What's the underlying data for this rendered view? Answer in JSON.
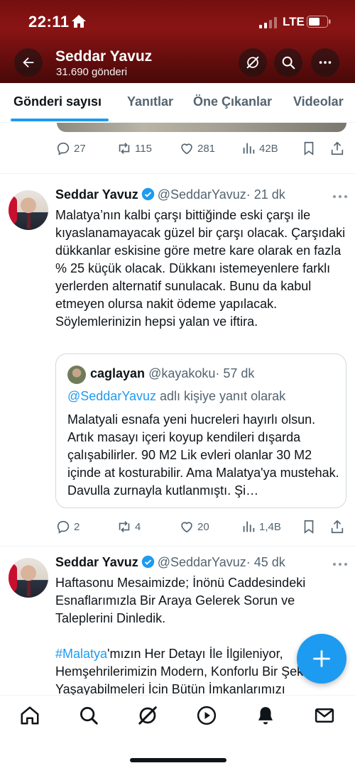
{
  "status_bar": {
    "time": "22:11",
    "network": "LTE"
  },
  "profile": {
    "name": "Seddar Yavuz",
    "post_count": "31.690 gönderi"
  },
  "tabs": [
    {
      "label": "Gönderi sayısı",
      "active": true
    },
    {
      "label": "Yanıtlar",
      "active": false
    },
    {
      "label": "Öne Çıkanlar",
      "active": false
    },
    {
      "label": "Videolar",
      "active": false
    }
  ],
  "tweets": [
    {
      "stats": {
        "replies": "27",
        "reposts": "115",
        "likes": "281",
        "views": "42B"
      }
    },
    {
      "author": "Seddar Yavuz",
      "handle": "@SeddarYavuz",
      "time": "· 21 dk",
      "text": "Malatya’nın kalbi çarşı bittiğinde eski çarşı ile kıyaslanamayacak güzel bir çarşı olacak. Çarşıdaki dükkanlar eskisine göre metre kare olarak en fazla % 25 küçük olacak. Dükkanı istemeyenlere farklı yerlerden alternatif sunulacak. Bunu da kabul etmeyen olursa nakit ödeme yapılacak. Söylemlerinizin hepsi yalan ve iftira.",
      "quote": {
        "author": "caglayan",
        "handle": "@kayakoku",
        "time": "· 57 dk",
        "reply_mention": "@SeddarYavuz",
        "reply_suffix": " adlı kişiye yanıt olarak",
        "text": "Malatyali esnafa yeni hucreleri hayırlı olsun. Artık masayı içeri koyup kendileri dışarda çalışabilirler. 90 M2 Lik evleri olanlar 30 M2 içinde at kosturabilir. Ama Malatya'ya mustehak. Davulla zurnayla kutlanmıştı. Şi…"
      },
      "stats": {
        "replies": "2",
        "reposts": "4",
        "likes": "20",
        "views": "1,4B"
      }
    },
    {
      "author": "Seddar Yavuz",
      "handle": "@SeddarYavuz",
      "time": "· 45 dk",
      "text": "Haftasonu Mesaimizde; İnönü Caddesindeki Esnaflarımızla Bir Araya Gelerek Sorun ve Taleplerini Dinledik.",
      "hashtag": "#Malatya",
      "text2": "'mızın Her Detayı İle İlgileniyor, Hemşehrilerimizin Modern, Konforlu Bir Şekilde Yaşayabilmeleri İcin Bütün İmkanlarımızı"
    }
  ],
  "colors": {
    "accent": "#1d9bf0",
    "header": "#a31818",
    "muted": "#536471"
  },
  "icons": {
    "back": "arrow-left-icon",
    "grok": "grok-icon",
    "search": "search-icon",
    "more": "more-icon",
    "nav": [
      "home-icon",
      "search-icon",
      "grok-icon",
      "play-icon",
      "bell-icon",
      "mail-icon"
    ],
    "fab": "plus-icon"
  }
}
